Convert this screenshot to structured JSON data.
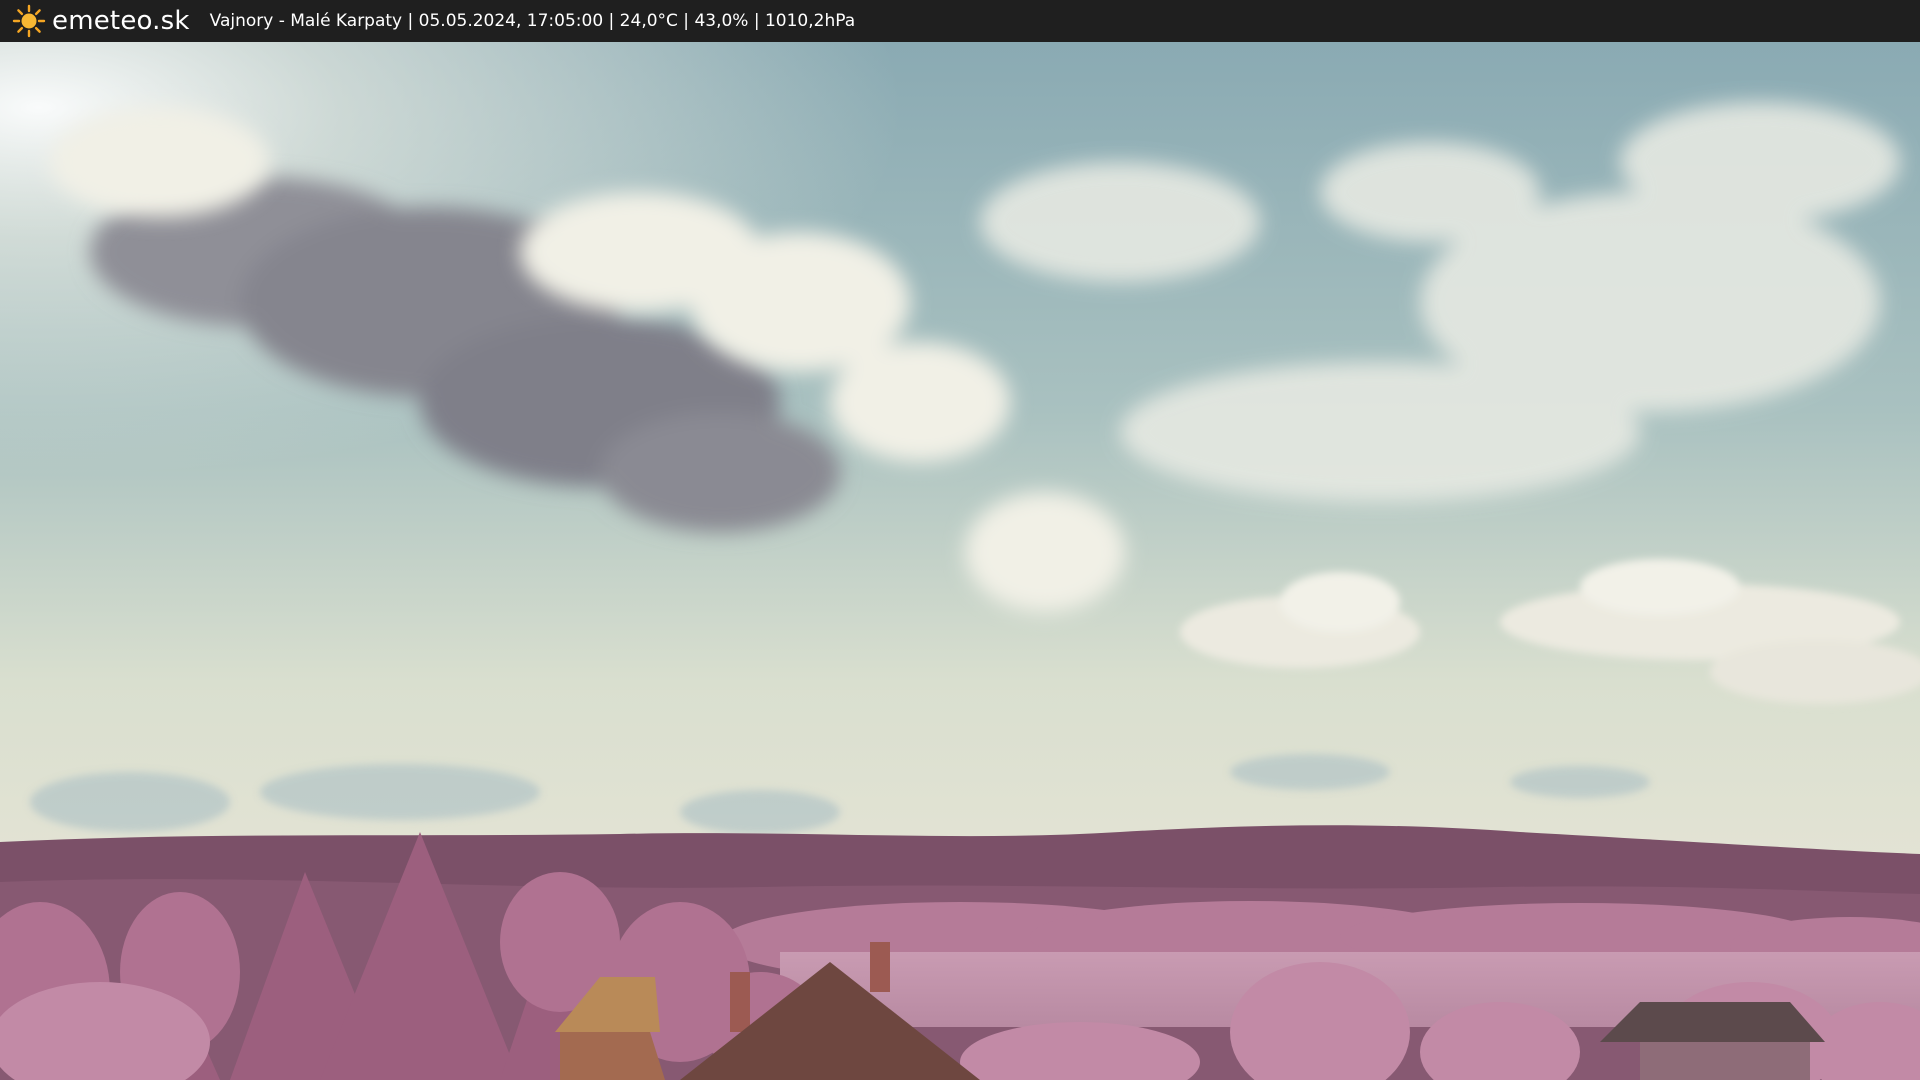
{
  "header": {
    "brand": "emeteo.sk",
    "caption": "Vajnory - Malé Karpaty | 05.05.2024, 17:05:00 | 24,0°C | 43,0% | 1010,2hPa",
    "icon": "sun-icon"
  },
  "colors": {
    "topbar": "#1f1f1f",
    "sun": "#f5a623",
    "sky_top": "#8fb0b8",
    "sky_horizon": "#dfe4d6",
    "hills": "#7a4f66",
    "foliage": "#b77a99"
  }
}
